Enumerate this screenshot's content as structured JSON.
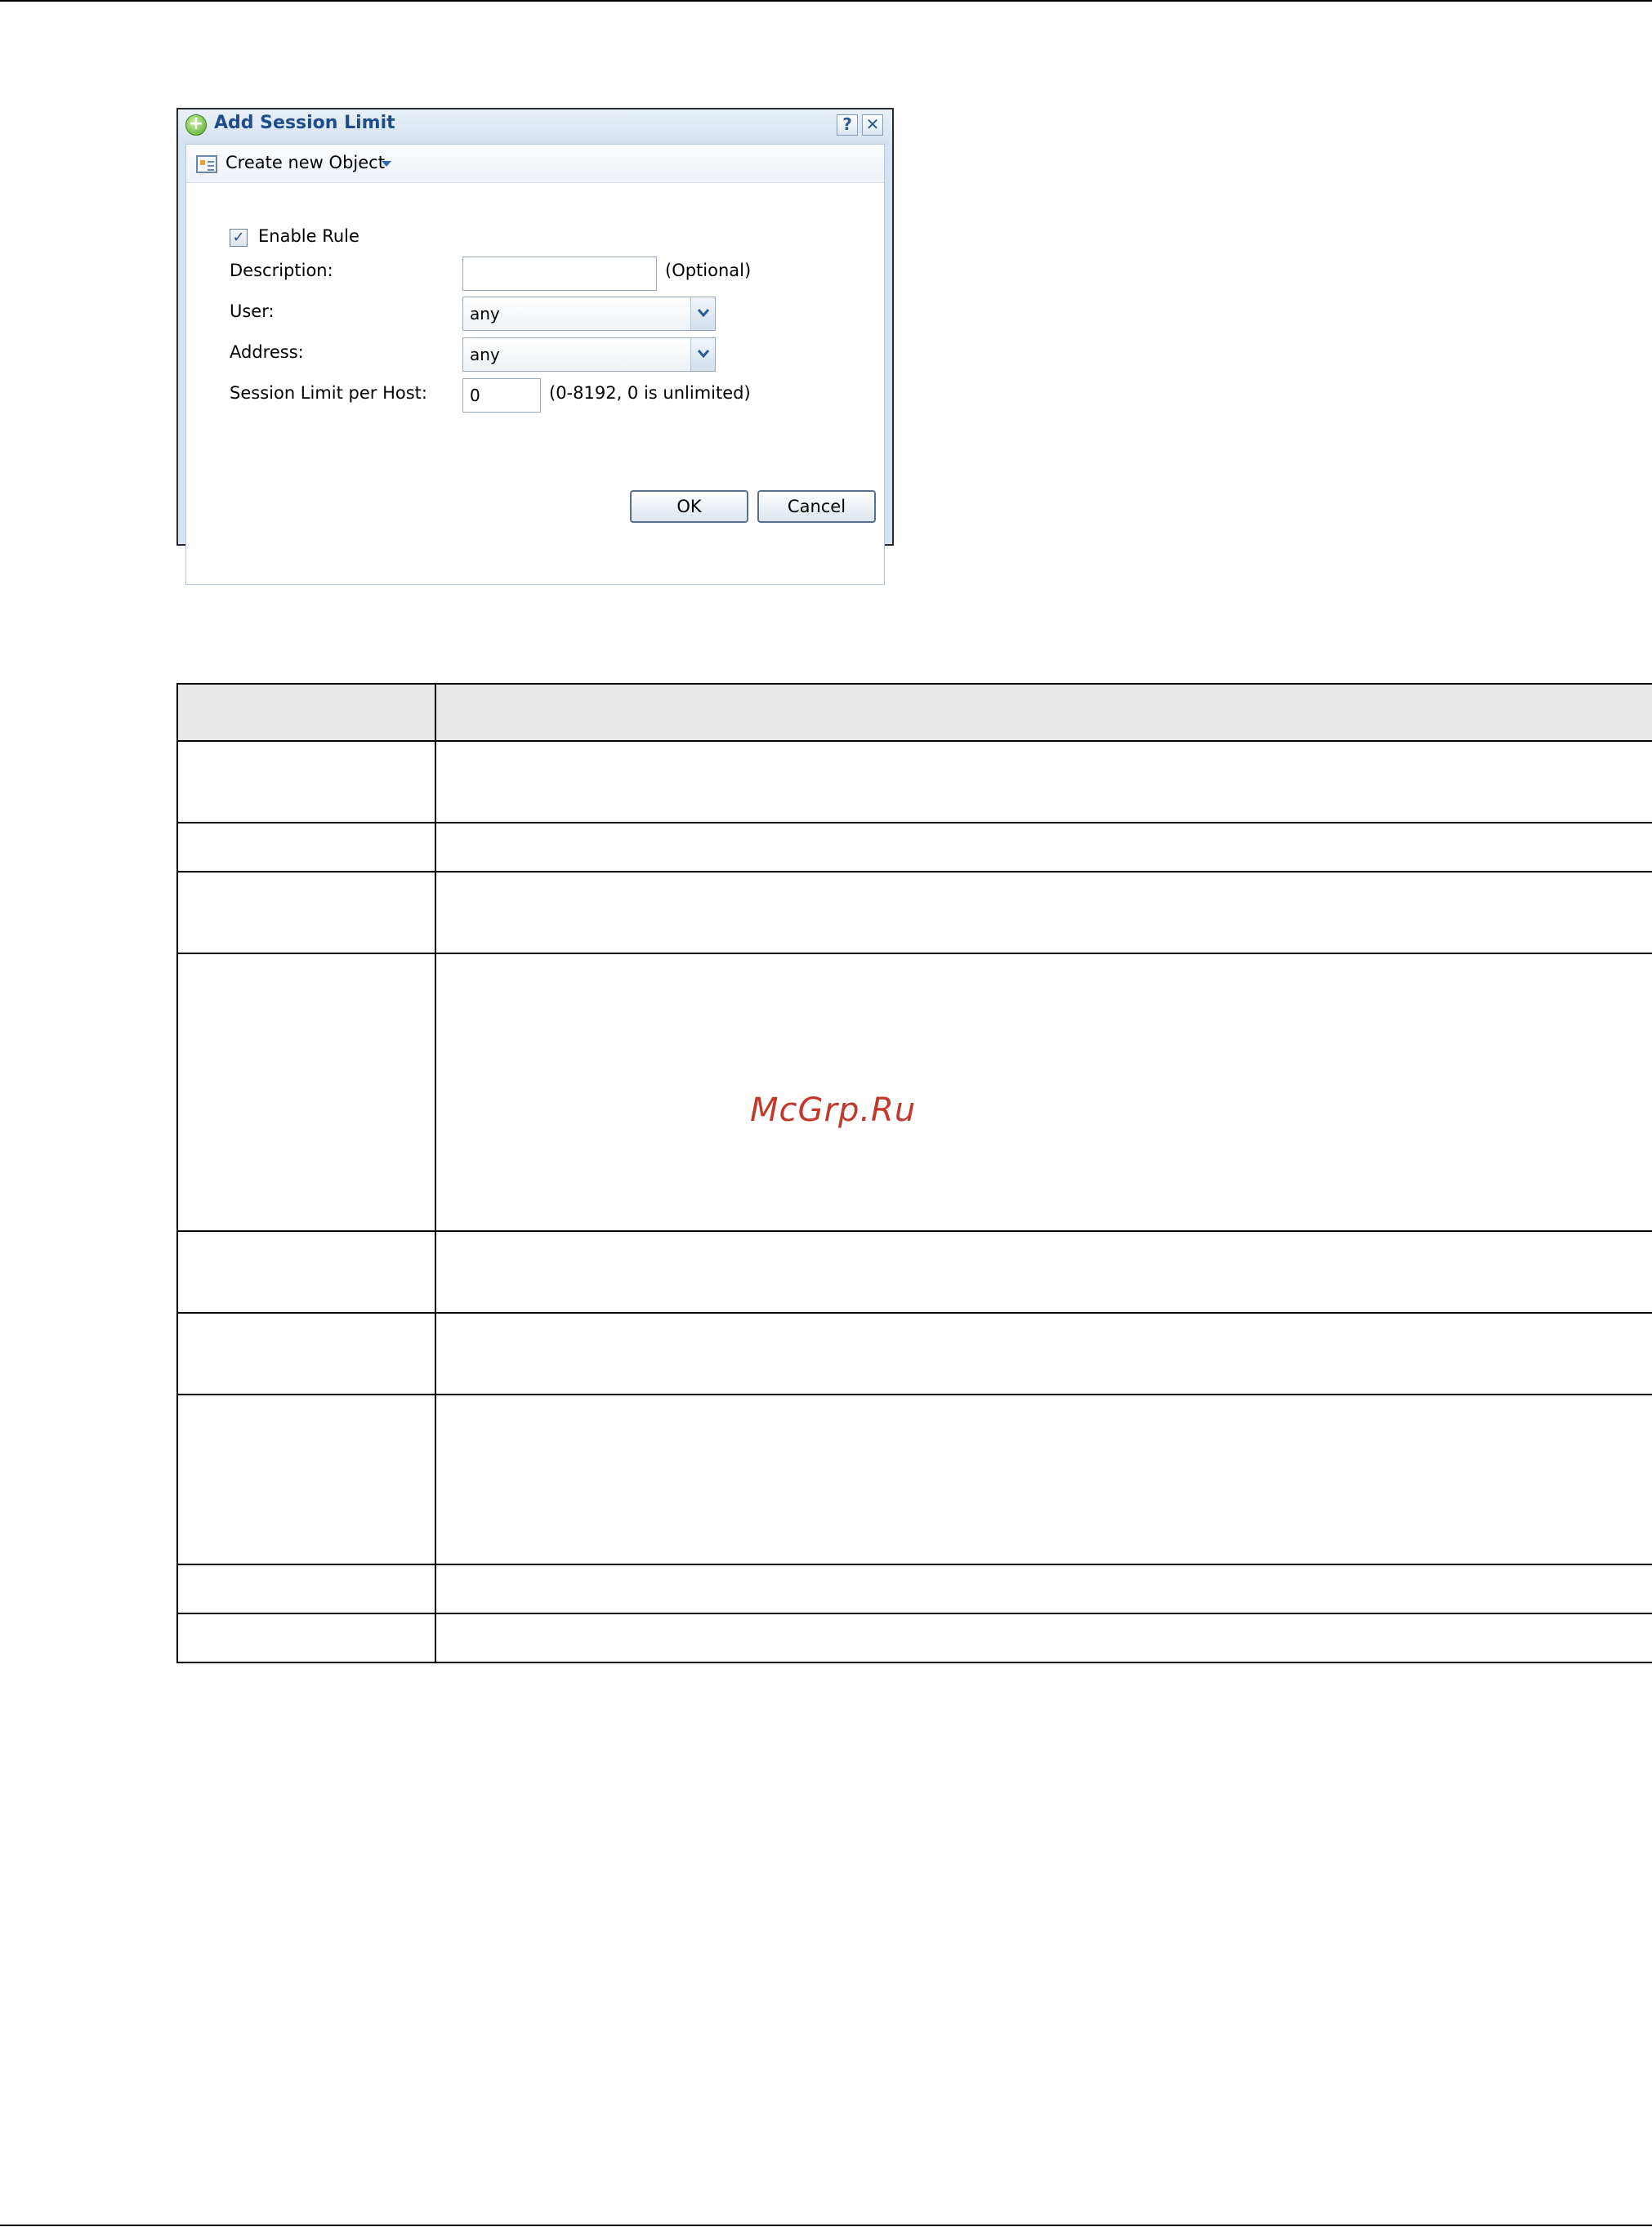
{
  "dialog": {
    "title": "Add Session Limit",
    "help_glyph": "?",
    "close_glyph": "✕",
    "toolbar": {
      "create_object_label": "Create new Object"
    },
    "enable_rule": {
      "label": "Enable Rule",
      "checked": true,
      "glyph": "✓"
    },
    "description": {
      "label": "Description:",
      "value": "",
      "hint": "(Optional)"
    },
    "user": {
      "label": "User:",
      "value": "any"
    },
    "address": {
      "label": "Address:",
      "value": "any"
    },
    "session_limit": {
      "label": "Session Limit per Host:",
      "value": "0",
      "hint": "(0-8192, 0 is unlimited)"
    },
    "ok_label": "OK",
    "cancel_label": "Cancel"
  },
  "watermark": "McGrp.Ru",
  "colors": {
    "title_text": "#1f4d8c",
    "dialog_frame": "#d5e2f1",
    "watermark": "#c0392b"
  }
}
